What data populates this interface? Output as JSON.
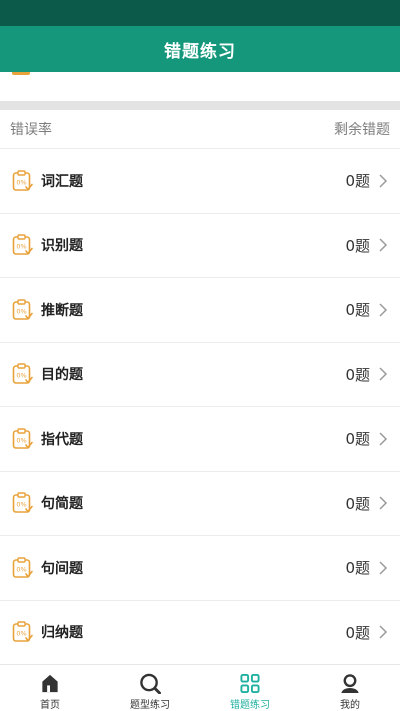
{
  "header": {
    "title": "错题练习"
  },
  "list_header": {
    "left": "错误率",
    "right": "剩余错题"
  },
  "rows": [
    {
      "label": "词汇题",
      "count": "0题",
      "rate": "0%"
    },
    {
      "label": "识别题",
      "count": "0题",
      "rate": "0%"
    },
    {
      "label": "推断题",
      "count": "0题",
      "rate": "0%"
    },
    {
      "label": "目的题",
      "count": "0题",
      "rate": "0%"
    },
    {
      "label": "指代题",
      "count": "0题",
      "rate": "0%"
    },
    {
      "label": "句简题",
      "count": "0题",
      "rate": "0%"
    },
    {
      "label": "句间题",
      "count": "0题",
      "rate": "0%"
    },
    {
      "label": "归纳题",
      "count": "0题",
      "rate": "0%"
    }
  ],
  "tabs": [
    {
      "label": "首页",
      "icon": "home-icon"
    },
    {
      "label": "题型练习",
      "icon": "search-icon"
    },
    {
      "label": "错题练习",
      "icon": "grid-icon",
      "active": true
    },
    {
      "label": "我的",
      "icon": "user-icon"
    }
  ],
  "colors": {
    "header": "#14977a",
    "status_bar": "#0b5a4a",
    "accent": "#e8a23a",
    "active_tab": "#1fb0a0"
  }
}
